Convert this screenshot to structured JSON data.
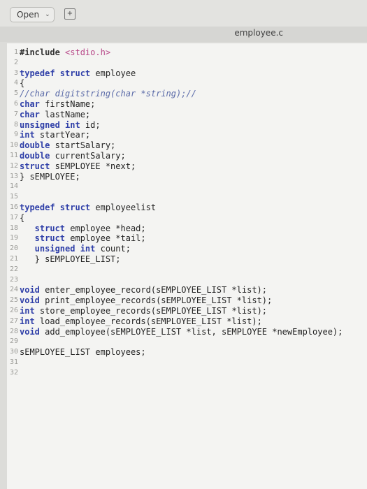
{
  "toolbar": {
    "open_label": "Open",
    "open_chevron_icon": "chevron-down-icon",
    "new_document_icon": "new-document-icon"
  },
  "tab": {
    "title": "employee.c"
  },
  "editor": {
    "lines": [
      {
        "n": "1",
        "tokens": [
          {
            "t": "#include ",
            "c": "pre"
          },
          {
            "t": "<stdio.h>",
            "c": "inc"
          }
        ]
      },
      {
        "n": "2",
        "tokens": []
      },
      {
        "n": "3",
        "tokens": [
          {
            "t": "typedef struct ",
            "c": "kw"
          },
          {
            "t": "employee",
            "c": ""
          }
        ]
      },
      {
        "n": "4",
        "tokens": [
          {
            "t": "{",
            "c": ""
          }
        ]
      },
      {
        "n": "5",
        "tokens": [
          {
            "t": "//char digitstring(char *string);//",
            "c": "com"
          }
        ]
      },
      {
        "n": "6",
        "tokens": [
          {
            "t": "char ",
            "c": "kw"
          },
          {
            "t": "firstName;",
            "c": ""
          }
        ]
      },
      {
        "n": "7",
        "tokens": [
          {
            "t": "char ",
            "c": "kw"
          },
          {
            "t": "lastName;",
            "c": ""
          }
        ]
      },
      {
        "n": "8",
        "tokens": [
          {
            "t": "unsigned int ",
            "c": "kw"
          },
          {
            "t": "id;",
            "c": ""
          }
        ]
      },
      {
        "n": "9",
        "tokens": [
          {
            "t": "int ",
            "c": "kw"
          },
          {
            "t": "startYear;",
            "c": ""
          }
        ]
      },
      {
        "n": "10",
        "tokens": [
          {
            "t": "double ",
            "c": "kw"
          },
          {
            "t": "startSalary;",
            "c": ""
          }
        ]
      },
      {
        "n": "11",
        "tokens": [
          {
            "t": "double ",
            "c": "kw"
          },
          {
            "t": "currentSalary;",
            "c": ""
          }
        ]
      },
      {
        "n": "12",
        "tokens": [
          {
            "t": "struct ",
            "c": "kw"
          },
          {
            "t": "sEMPLOYEE *next;",
            "c": ""
          }
        ]
      },
      {
        "n": "13",
        "tokens": [
          {
            "t": "} sEMPLOYEE;",
            "c": ""
          }
        ]
      },
      {
        "n": "14",
        "tokens": []
      },
      {
        "n": "15",
        "tokens": []
      },
      {
        "n": "16",
        "tokens": [
          {
            "t": "typedef struct ",
            "c": "kw"
          },
          {
            "t": "employeelist",
            "c": ""
          }
        ]
      },
      {
        "n": "17",
        "tokens": [
          {
            "t": "{",
            "c": ""
          }
        ]
      },
      {
        "n": "18",
        "tokens": [
          {
            "t": "   struct ",
            "c": "kw"
          },
          {
            "t": "employee *head;",
            "c": ""
          }
        ]
      },
      {
        "n": "19",
        "tokens": [
          {
            "t": "   struct ",
            "c": "kw"
          },
          {
            "t": "employee *tail;",
            "c": ""
          }
        ]
      },
      {
        "n": "20",
        "tokens": [
          {
            "t": "   unsigned int ",
            "c": "kw"
          },
          {
            "t": "count;",
            "c": ""
          }
        ]
      },
      {
        "n": "21",
        "tokens": [
          {
            "t": "   } sEMPLOYEE_LIST;",
            "c": ""
          }
        ]
      },
      {
        "n": "22",
        "tokens": []
      },
      {
        "n": "23",
        "tokens": []
      },
      {
        "n": "24",
        "tokens": [
          {
            "t": "void ",
            "c": "kw"
          },
          {
            "t": "enter_employee_record(sEMPLOYEE_LIST *list);",
            "c": ""
          }
        ]
      },
      {
        "n": "25",
        "tokens": [
          {
            "t": "void ",
            "c": "kw"
          },
          {
            "t": "print_employee_records(sEMPLOYEE_LIST *list);",
            "c": ""
          }
        ]
      },
      {
        "n": "26",
        "tokens": [
          {
            "t": "int ",
            "c": "kw"
          },
          {
            "t": "store_employee_records(sEMPLOYEE_LIST *list);",
            "c": ""
          }
        ]
      },
      {
        "n": "27",
        "tokens": [
          {
            "t": "int ",
            "c": "kw"
          },
          {
            "t": "load_employee_records(sEMPLOYEE_LIST *list);",
            "c": ""
          }
        ]
      },
      {
        "n": "28",
        "tokens": [
          {
            "t": "void ",
            "c": "kw"
          },
          {
            "t": "add_employee(sEMPLOYEE_LIST *list, sEMPLOYEE *newEmployee);",
            "c": ""
          }
        ]
      },
      {
        "n": "29",
        "tokens": []
      },
      {
        "n": "30",
        "tokens": [
          {
            "t": "sEMPLOYEE_LIST employees;",
            "c": ""
          }
        ]
      },
      {
        "n": "31",
        "tokens": []
      },
      {
        "n": "32",
        "tokens": []
      }
    ]
  }
}
